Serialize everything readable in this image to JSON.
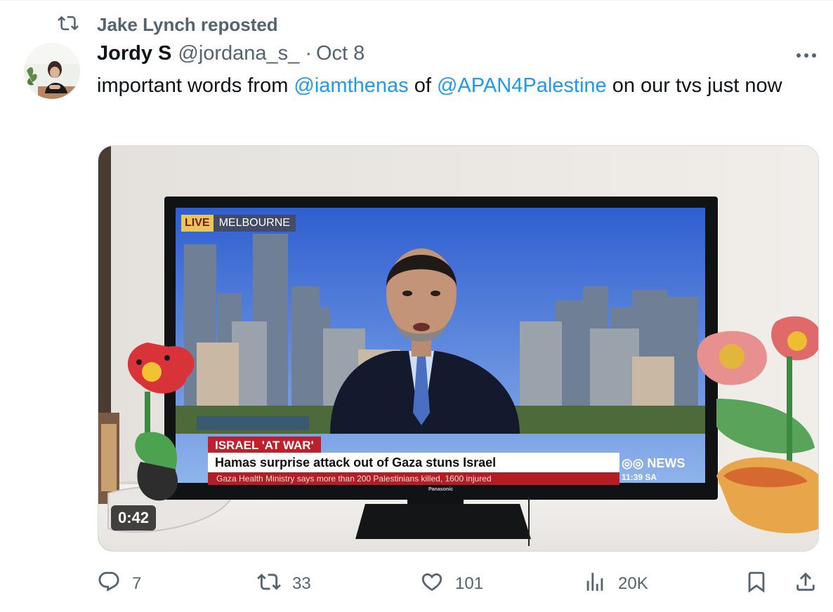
{
  "repost": {
    "text": "Jake Lynch reposted",
    "icon": "repost-icon"
  },
  "author": {
    "display_name": "Jordy S",
    "handle": "@jordana_s_",
    "separator": "·",
    "date": "Oct 8"
  },
  "tweet": {
    "text_before": "important words from ",
    "mention_1": "@iamthenas",
    "text_middle": " of ",
    "mention_2": "@APAN4Palestine",
    "text_after": " on our tvs just now"
  },
  "media": {
    "duration": "0:42",
    "tv": {
      "live": "LIVE",
      "city": "MELBOURNE",
      "headline_tag": "ISRAEL 'AT WAR'",
      "headline": "Hamas surprise attack out of Gaza stuns Israel",
      "ticker": "Gaza Health Ministry says more than 200 Palestinians killed, 1600 injured",
      "channel": "NEWS",
      "time": "11:39",
      "time_zone": "SA",
      "brand": "Panasonic"
    }
  },
  "actions": {
    "replies": "7",
    "reposts": "33",
    "likes": "101",
    "views": "20K"
  },
  "colors": {
    "accent": "#1d9bf0",
    "muted": "#536471",
    "text": "#0f1419"
  }
}
